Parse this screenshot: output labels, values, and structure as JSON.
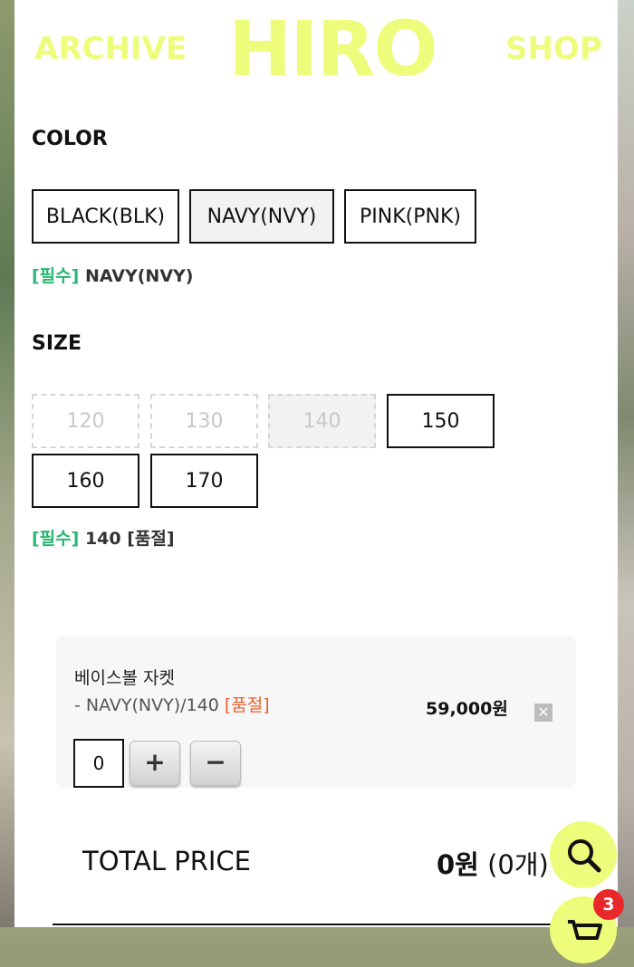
{
  "header": {
    "archive": "ARCHIVE",
    "logo": "HIRO",
    "shop": "SHOP"
  },
  "color_section": {
    "label": "COLOR",
    "options": [
      "BLACK(BLK)",
      "NAVY(NVY)",
      "PINK(PNK)"
    ],
    "selected": "NAVY(NVY)",
    "required_tag": "[필수]",
    "required_value": "NAVY(NVY)"
  },
  "size_section": {
    "label": "SIZE",
    "options": [
      "120",
      "130",
      "140",
      "150",
      "160",
      "170"
    ],
    "selected": "140",
    "required_tag": "[필수]",
    "required_value": "140 [품절]"
  },
  "cart_item": {
    "name": "베이스볼 자켓",
    "option": "- NAVY(NVY)/140",
    "soldout": "[품절]",
    "price": "59,000원",
    "remove": "✕",
    "quantity": "0",
    "plus": "+",
    "minus": "−"
  },
  "total": {
    "label": "TOTAL PRICE",
    "amount": "0원",
    "count": "(0개)"
  },
  "cart_badge": "3",
  "colors": {
    "accent_yellow": "#eefc7b",
    "required_green": "#2bb673",
    "soldout_orange": "#e8602e",
    "badge_red": "#e8282b"
  }
}
